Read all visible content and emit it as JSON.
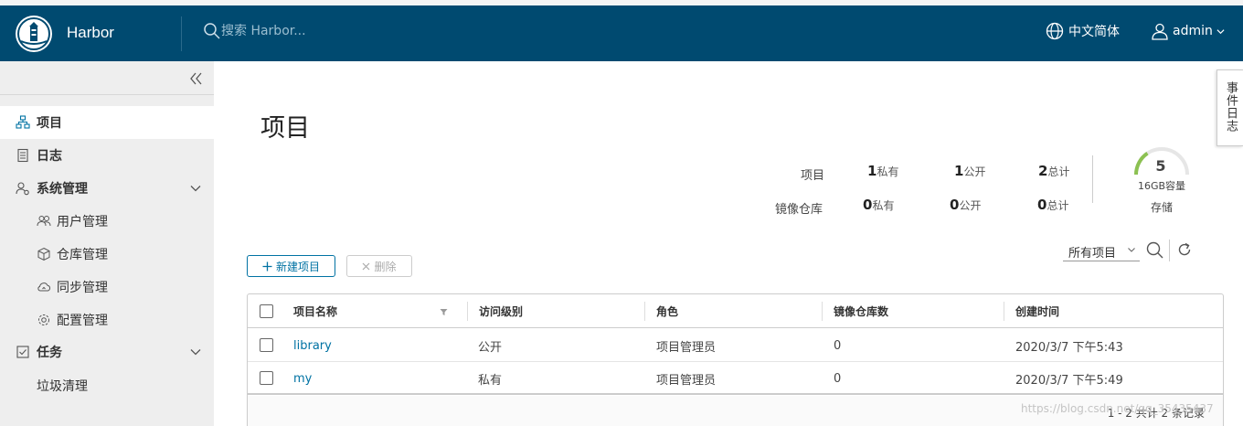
{
  "header": {
    "brand": "Harbor",
    "search_placeholder": "搜索 Harbor...",
    "language": "中文简体",
    "user": "admin"
  },
  "sidebar": {
    "items": [
      {
        "label": "项目",
        "icon": "projects-icon",
        "active": true
      },
      {
        "label": "日志",
        "icon": "logs-icon"
      },
      {
        "label": "系统管理",
        "icon": "system-admin-icon"
      },
      {
        "label": "用户管理",
        "icon": "users-icon"
      },
      {
        "label": "仓库管理",
        "icon": "registry-icon"
      },
      {
        "label": "同步管理",
        "icon": "replication-icon"
      },
      {
        "label": "配置管理",
        "icon": "configuration-icon"
      },
      {
        "label": "任务",
        "icon": "tasks-icon"
      },
      {
        "label": "垃圾清理"
      }
    ]
  },
  "main": {
    "title": "项目",
    "stats": {
      "projects_label": "项目",
      "repos_label": "镜像仓库",
      "private_unit": "私有",
      "public_unit": "公开",
      "total_unit": "总计",
      "projects": {
        "private": "1",
        "public": "1",
        "total": "2"
      },
      "repos": {
        "private": "0",
        "public": "0",
        "total": "0"
      }
    },
    "storage": {
      "value": "5",
      "capacity": "16GB容量",
      "label": "存储",
      "used_fraction": 0.3125
    },
    "event_log_tab": "事件日志",
    "new_project_button": "新建项目",
    "delete_button": "删除",
    "filter_select": "所有项目",
    "table": {
      "columns": [
        "项目名称",
        "访问级别",
        "角色",
        "镜像仓库数",
        "创建时间"
      ],
      "rows": [
        {
          "name": "library",
          "access": "公开",
          "role": "项目管理员",
          "repos": "0",
          "created": "2020/3/7 下午5:43"
        },
        {
          "name": "my",
          "access": "私有",
          "role": "项目管理员",
          "repos": "0",
          "created": "2020/3/7 下午5:49"
        }
      ],
      "footer": "1 - 2 共计 2 条记录"
    },
    "watermark": "https://blog.csdn.net/qq_35435437"
  },
  "colors": {
    "header_bg": "#004a70",
    "accent": "#0072a3",
    "gauge": "#8cc152"
  }
}
